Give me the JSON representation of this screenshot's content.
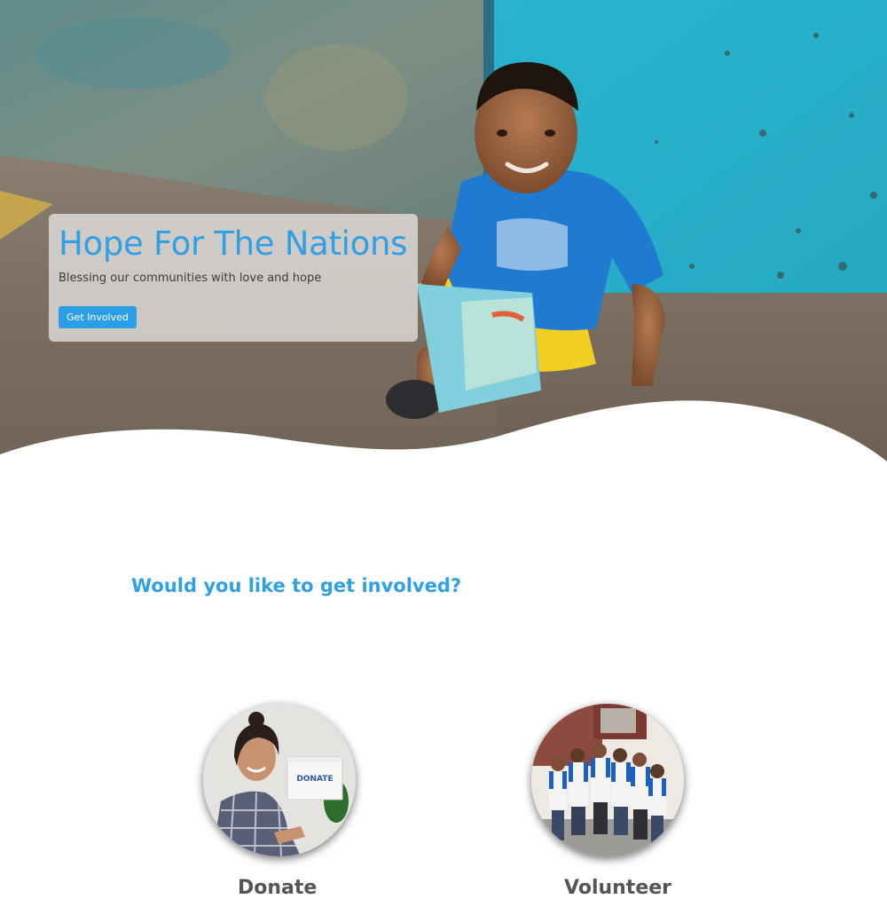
{
  "hero": {
    "title": "Hope For The Nations",
    "subtitle": "Blessing our communities with love and hope",
    "cta_label": "Get Involved"
  },
  "involved": {
    "heading": "Would you like to get involved?",
    "cards": [
      {
        "label": "Donate",
        "image": "woman-holding-donate-box",
        "box_text": "DONATE"
      },
      {
        "label": "Volunteer",
        "image": "group-of-volunteers"
      }
    ]
  },
  "colors": {
    "accent": "#2fa0e6",
    "button": "#2c9ee8",
    "wall_left": "#6d8c86",
    "wall_right": "#27b6cf",
    "shirt": "#1f7bd1",
    "shorts": "#f2d020"
  }
}
